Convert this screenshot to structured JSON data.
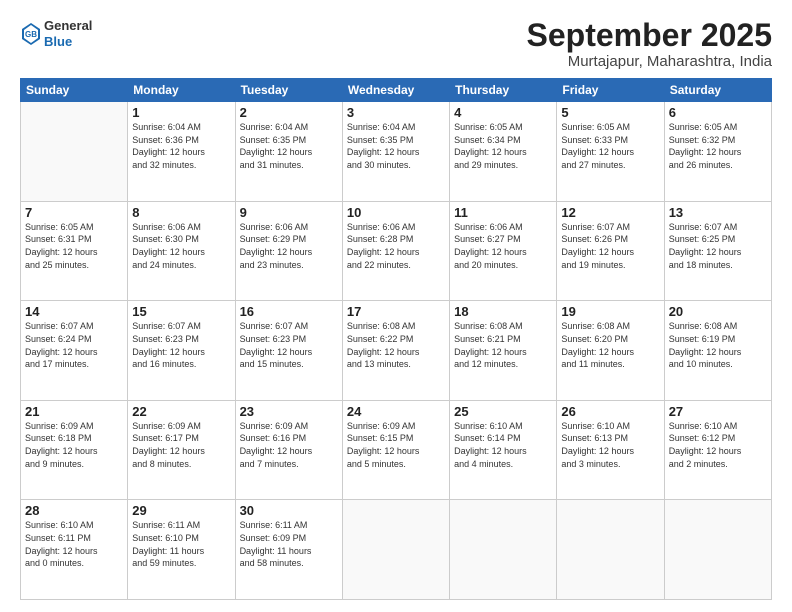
{
  "logo": {
    "line1": "General",
    "line2": "Blue"
  },
  "title": "September 2025",
  "location": "Murtajapur, Maharashtra, India",
  "weekdays": [
    "Sunday",
    "Monday",
    "Tuesday",
    "Wednesday",
    "Thursday",
    "Friday",
    "Saturday"
  ],
  "weeks": [
    [
      {
        "num": "",
        "info": ""
      },
      {
        "num": "1",
        "info": "Sunrise: 6:04 AM\nSunset: 6:36 PM\nDaylight: 12 hours\nand 32 minutes."
      },
      {
        "num": "2",
        "info": "Sunrise: 6:04 AM\nSunset: 6:35 PM\nDaylight: 12 hours\nand 31 minutes."
      },
      {
        "num": "3",
        "info": "Sunrise: 6:04 AM\nSunset: 6:35 PM\nDaylight: 12 hours\nand 30 minutes."
      },
      {
        "num": "4",
        "info": "Sunrise: 6:05 AM\nSunset: 6:34 PM\nDaylight: 12 hours\nand 29 minutes."
      },
      {
        "num": "5",
        "info": "Sunrise: 6:05 AM\nSunset: 6:33 PM\nDaylight: 12 hours\nand 27 minutes."
      },
      {
        "num": "6",
        "info": "Sunrise: 6:05 AM\nSunset: 6:32 PM\nDaylight: 12 hours\nand 26 minutes."
      }
    ],
    [
      {
        "num": "7",
        "info": "Sunrise: 6:05 AM\nSunset: 6:31 PM\nDaylight: 12 hours\nand 25 minutes."
      },
      {
        "num": "8",
        "info": "Sunrise: 6:06 AM\nSunset: 6:30 PM\nDaylight: 12 hours\nand 24 minutes."
      },
      {
        "num": "9",
        "info": "Sunrise: 6:06 AM\nSunset: 6:29 PM\nDaylight: 12 hours\nand 23 minutes."
      },
      {
        "num": "10",
        "info": "Sunrise: 6:06 AM\nSunset: 6:28 PM\nDaylight: 12 hours\nand 22 minutes."
      },
      {
        "num": "11",
        "info": "Sunrise: 6:06 AM\nSunset: 6:27 PM\nDaylight: 12 hours\nand 20 minutes."
      },
      {
        "num": "12",
        "info": "Sunrise: 6:07 AM\nSunset: 6:26 PM\nDaylight: 12 hours\nand 19 minutes."
      },
      {
        "num": "13",
        "info": "Sunrise: 6:07 AM\nSunset: 6:25 PM\nDaylight: 12 hours\nand 18 minutes."
      }
    ],
    [
      {
        "num": "14",
        "info": "Sunrise: 6:07 AM\nSunset: 6:24 PM\nDaylight: 12 hours\nand 17 minutes."
      },
      {
        "num": "15",
        "info": "Sunrise: 6:07 AM\nSunset: 6:23 PM\nDaylight: 12 hours\nand 16 minutes."
      },
      {
        "num": "16",
        "info": "Sunrise: 6:07 AM\nSunset: 6:23 PM\nDaylight: 12 hours\nand 15 minutes."
      },
      {
        "num": "17",
        "info": "Sunrise: 6:08 AM\nSunset: 6:22 PM\nDaylight: 12 hours\nand 13 minutes."
      },
      {
        "num": "18",
        "info": "Sunrise: 6:08 AM\nSunset: 6:21 PM\nDaylight: 12 hours\nand 12 minutes."
      },
      {
        "num": "19",
        "info": "Sunrise: 6:08 AM\nSunset: 6:20 PM\nDaylight: 12 hours\nand 11 minutes."
      },
      {
        "num": "20",
        "info": "Sunrise: 6:08 AM\nSunset: 6:19 PM\nDaylight: 12 hours\nand 10 minutes."
      }
    ],
    [
      {
        "num": "21",
        "info": "Sunrise: 6:09 AM\nSunset: 6:18 PM\nDaylight: 12 hours\nand 9 minutes."
      },
      {
        "num": "22",
        "info": "Sunrise: 6:09 AM\nSunset: 6:17 PM\nDaylight: 12 hours\nand 8 minutes."
      },
      {
        "num": "23",
        "info": "Sunrise: 6:09 AM\nSunset: 6:16 PM\nDaylight: 12 hours\nand 7 minutes."
      },
      {
        "num": "24",
        "info": "Sunrise: 6:09 AM\nSunset: 6:15 PM\nDaylight: 12 hours\nand 5 minutes."
      },
      {
        "num": "25",
        "info": "Sunrise: 6:10 AM\nSunset: 6:14 PM\nDaylight: 12 hours\nand 4 minutes."
      },
      {
        "num": "26",
        "info": "Sunrise: 6:10 AM\nSunset: 6:13 PM\nDaylight: 12 hours\nand 3 minutes."
      },
      {
        "num": "27",
        "info": "Sunrise: 6:10 AM\nSunset: 6:12 PM\nDaylight: 12 hours\nand 2 minutes."
      }
    ],
    [
      {
        "num": "28",
        "info": "Sunrise: 6:10 AM\nSunset: 6:11 PM\nDaylight: 12 hours\nand 0 minutes."
      },
      {
        "num": "29",
        "info": "Sunrise: 6:11 AM\nSunset: 6:10 PM\nDaylight: 11 hours\nand 59 minutes."
      },
      {
        "num": "30",
        "info": "Sunrise: 6:11 AM\nSunset: 6:09 PM\nDaylight: 11 hours\nand 58 minutes."
      },
      {
        "num": "",
        "info": ""
      },
      {
        "num": "",
        "info": ""
      },
      {
        "num": "",
        "info": ""
      },
      {
        "num": "",
        "info": ""
      }
    ]
  ]
}
